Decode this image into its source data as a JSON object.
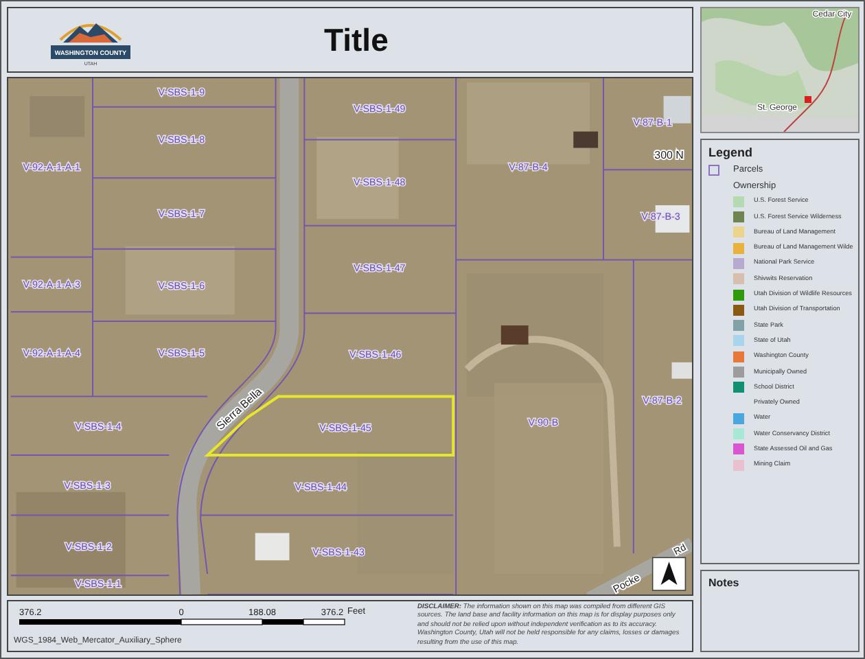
{
  "header": {
    "logo": {
      "name": "WASHINGTON COUNTY",
      "state": "UTAH"
    },
    "title": "Title"
  },
  "locator_map": {
    "labels": [
      "Cedar City",
      "St. George"
    ]
  },
  "map": {
    "parcels": [
      {
        "label": "V-SBS-1-9",
        "selected": false
      },
      {
        "label": "V-SBS-1-8",
        "selected": false
      },
      {
        "label": "V-92-A-1-A-1",
        "selected": false
      },
      {
        "label": "V-SBS-1-7",
        "selected": false
      },
      {
        "label": "V-92-A-1-A-3",
        "selected": false
      },
      {
        "label": "V-SBS-1-6",
        "selected": false
      },
      {
        "label": "V-SBS-1-49",
        "selected": false
      },
      {
        "label": "V-SBS-1-48",
        "selected": false
      },
      {
        "label": "V-SBS-1-47",
        "selected": false
      },
      {
        "label": "V-92-A-1-A-4",
        "selected": false
      },
      {
        "label": "V-SBS-1-5",
        "selected": false
      },
      {
        "label": "V-SBS-1-46",
        "selected": false
      },
      {
        "label": "V-SBS-1-4",
        "selected": false
      },
      {
        "label": "V-SBS-1-45",
        "selected": true
      },
      {
        "label": "V-SBS-1-3",
        "selected": false
      },
      {
        "label": "V-SBS-1-44",
        "selected": false
      },
      {
        "label": "V-SBS-1-2",
        "selected": false
      },
      {
        "label": "V-SBS-1-43",
        "selected": false
      },
      {
        "label": "V-SBS-1-1",
        "selected": false
      },
      {
        "label": "V-87-B-4",
        "selected": false
      },
      {
        "label": "V-87-B-1",
        "selected": false
      },
      {
        "label": "V-87-B-3",
        "selected": false
      },
      {
        "label": "V-90-B",
        "selected": false
      },
      {
        "label": "V-87-B-2",
        "selected": false
      }
    ],
    "roads": [
      "Sierra Bella",
      "300 N",
      "Pocke",
      "Rd"
    ]
  },
  "legend": {
    "title": "Legend",
    "items": [
      {
        "kind": "outline",
        "label": "Parcels",
        "color": "#8a72c0"
      },
      {
        "kind": "heading",
        "label": "Ownership"
      },
      {
        "kind": "swatch",
        "label": "U.S. Forest Service",
        "color": "#b5d9b0"
      },
      {
        "kind": "swatch",
        "label": "U.S. Forest Service Wilderness",
        "color": "#6f8450"
      },
      {
        "kind": "swatch",
        "label": "Bureau of Land Management",
        "color": "#ead58a"
      },
      {
        "kind": "swatch",
        "label": "Bureau of Land Management Wilde",
        "color": "#e8b23c"
      },
      {
        "kind": "swatch",
        "label": "National Park Service",
        "color": "#b8a9cf"
      },
      {
        "kind": "swatch",
        "label": "Shivwits Reservation",
        "color": "#d6bfae"
      },
      {
        "kind": "swatch",
        "label": "Utah Division of Wildlife Resources",
        "color": "#2e9a0c"
      },
      {
        "kind": "swatch",
        "label": "Utah Division of Transportation",
        "color": "#8a5a10"
      },
      {
        "kind": "swatch",
        "label": "State Park",
        "color": "#7fa3a8"
      },
      {
        "kind": "swatch",
        "label": "State of Utah",
        "color": "#a8d4ee"
      },
      {
        "kind": "swatch",
        "label": "Washington County",
        "color": "#e8773a"
      },
      {
        "kind": "swatch",
        "label": "Municipally Owned",
        "color": "#9c9c9c"
      },
      {
        "kind": "swatch",
        "label": "School District",
        "color": "#0f9070"
      },
      {
        "kind": "plain",
        "label": "Privately Owned"
      },
      {
        "kind": "swatch",
        "label": "Water",
        "color": "#4aa6dc"
      },
      {
        "kind": "swatch",
        "label": "Water Conservancy District",
        "color": "#a6e8d4"
      },
      {
        "kind": "swatch",
        "label": "State Assessed Oil and Gas",
        "color": "#d856d0"
      },
      {
        "kind": "swatch",
        "label": "Mining Claim",
        "color": "#e8c0cf"
      }
    ]
  },
  "notes": {
    "title": "Notes"
  },
  "scale_bar": {
    "labels": [
      "376.2",
      "0",
      "188.08",
      "376.2"
    ],
    "unit": "Feet"
  },
  "projection": "WGS_1984_Web_Mercator_Auxiliary_Sphere",
  "disclaimer": "**DISCLAIMER:** The information shown on this map was compiled from different GIS sources. The land base and facility information on this map is for display purposes only and should not be relied upon without independent verification as to its accuracy. Washington County, Utah will not be held responsible for any claims, losses or damages resulting from the use of this map."
}
